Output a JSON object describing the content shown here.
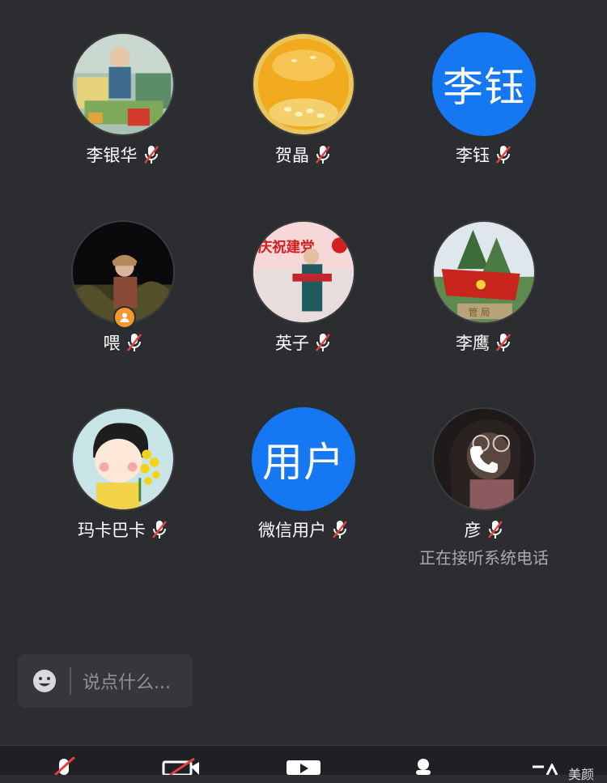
{
  "participants": [
    {
      "name": "李银华",
      "avatar_kind": "photo",
      "muted": true
    },
    {
      "name": "贺晶",
      "avatar_kind": "photo",
      "muted": true
    },
    {
      "name": "李钰",
      "avatar_kind": "text",
      "avatar_text": "李钰",
      "muted": true
    },
    {
      "name": "喂",
      "avatar_kind": "photo",
      "muted": true,
      "host_badge": true
    },
    {
      "name": "英子",
      "avatar_kind": "photo",
      "muted": true
    },
    {
      "name": "李鹰",
      "avatar_kind": "photo",
      "muted": true
    },
    {
      "name": "玛卡巴卡",
      "avatar_kind": "photo",
      "muted": true
    },
    {
      "name": "微信用户",
      "avatar_kind": "text",
      "avatar_text": "用户",
      "muted": true
    },
    {
      "name": "彦",
      "avatar_kind": "photo",
      "muted": true,
      "status": "正在接听系统电话"
    }
  ],
  "banner_text": "庆祝建党",
  "photo_caption": "管 局",
  "chat": {
    "placeholder": "说点什么..."
  },
  "toolbar": {
    "partial_label": "美颜"
  },
  "colors": {
    "background": "#2b2d31",
    "text_avatar": "#1677f3",
    "muted_red": "#e84040",
    "host_badge": "#f29a2e"
  }
}
